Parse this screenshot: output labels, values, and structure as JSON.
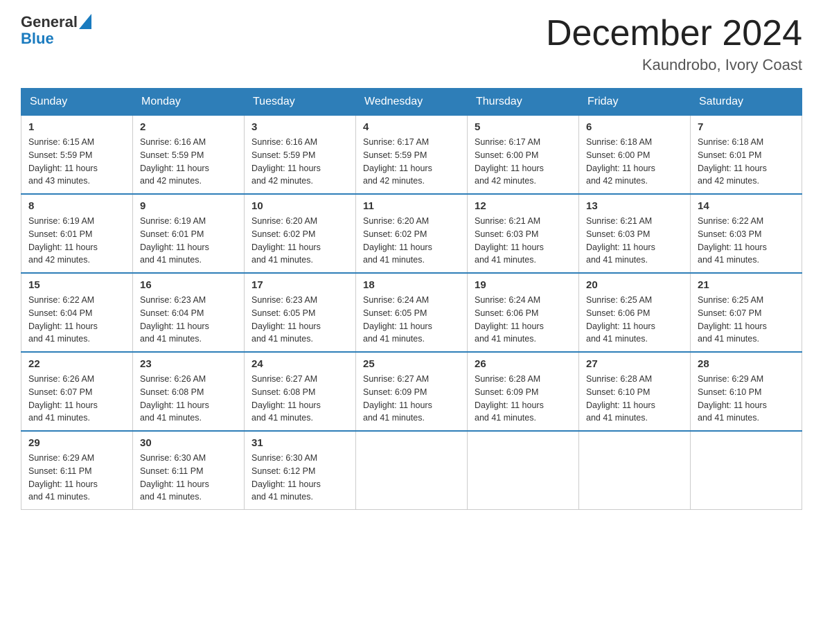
{
  "header": {
    "logo": {
      "general": "General",
      "blue": "Blue"
    },
    "title": "December 2024",
    "location": "Kaundrobo, Ivory Coast"
  },
  "days_of_week": [
    "Sunday",
    "Monday",
    "Tuesday",
    "Wednesday",
    "Thursday",
    "Friday",
    "Saturday"
  ],
  "weeks": [
    [
      {
        "day": "1",
        "sunrise": "6:15 AM",
        "sunset": "5:59 PM",
        "daylight": "11 hours and 43 minutes."
      },
      {
        "day": "2",
        "sunrise": "6:16 AM",
        "sunset": "5:59 PM",
        "daylight": "11 hours and 42 minutes."
      },
      {
        "day": "3",
        "sunrise": "6:16 AM",
        "sunset": "5:59 PM",
        "daylight": "11 hours and 42 minutes."
      },
      {
        "day": "4",
        "sunrise": "6:17 AM",
        "sunset": "5:59 PM",
        "daylight": "11 hours and 42 minutes."
      },
      {
        "day": "5",
        "sunrise": "6:17 AM",
        "sunset": "6:00 PM",
        "daylight": "11 hours and 42 minutes."
      },
      {
        "day": "6",
        "sunrise": "6:18 AM",
        "sunset": "6:00 PM",
        "daylight": "11 hours and 42 minutes."
      },
      {
        "day": "7",
        "sunrise": "6:18 AM",
        "sunset": "6:01 PM",
        "daylight": "11 hours and 42 minutes."
      }
    ],
    [
      {
        "day": "8",
        "sunrise": "6:19 AM",
        "sunset": "6:01 PM",
        "daylight": "11 hours and 42 minutes."
      },
      {
        "day": "9",
        "sunrise": "6:19 AM",
        "sunset": "6:01 PM",
        "daylight": "11 hours and 41 minutes."
      },
      {
        "day": "10",
        "sunrise": "6:20 AM",
        "sunset": "6:02 PM",
        "daylight": "11 hours and 41 minutes."
      },
      {
        "day": "11",
        "sunrise": "6:20 AM",
        "sunset": "6:02 PM",
        "daylight": "11 hours and 41 minutes."
      },
      {
        "day": "12",
        "sunrise": "6:21 AM",
        "sunset": "6:03 PM",
        "daylight": "11 hours and 41 minutes."
      },
      {
        "day": "13",
        "sunrise": "6:21 AM",
        "sunset": "6:03 PM",
        "daylight": "11 hours and 41 minutes."
      },
      {
        "day": "14",
        "sunrise": "6:22 AM",
        "sunset": "6:03 PM",
        "daylight": "11 hours and 41 minutes."
      }
    ],
    [
      {
        "day": "15",
        "sunrise": "6:22 AM",
        "sunset": "6:04 PM",
        "daylight": "11 hours and 41 minutes."
      },
      {
        "day": "16",
        "sunrise": "6:23 AM",
        "sunset": "6:04 PM",
        "daylight": "11 hours and 41 minutes."
      },
      {
        "day": "17",
        "sunrise": "6:23 AM",
        "sunset": "6:05 PM",
        "daylight": "11 hours and 41 minutes."
      },
      {
        "day": "18",
        "sunrise": "6:24 AM",
        "sunset": "6:05 PM",
        "daylight": "11 hours and 41 minutes."
      },
      {
        "day": "19",
        "sunrise": "6:24 AM",
        "sunset": "6:06 PM",
        "daylight": "11 hours and 41 minutes."
      },
      {
        "day": "20",
        "sunrise": "6:25 AM",
        "sunset": "6:06 PM",
        "daylight": "11 hours and 41 minutes."
      },
      {
        "day": "21",
        "sunrise": "6:25 AM",
        "sunset": "6:07 PM",
        "daylight": "11 hours and 41 minutes."
      }
    ],
    [
      {
        "day": "22",
        "sunrise": "6:26 AM",
        "sunset": "6:07 PM",
        "daylight": "11 hours and 41 minutes."
      },
      {
        "day": "23",
        "sunrise": "6:26 AM",
        "sunset": "6:08 PM",
        "daylight": "11 hours and 41 minutes."
      },
      {
        "day": "24",
        "sunrise": "6:27 AM",
        "sunset": "6:08 PM",
        "daylight": "11 hours and 41 minutes."
      },
      {
        "day": "25",
        "sunrise": "6:27 AM",
        "sunset": "6:09 PM",
        "daylight": "11 hours and 41 minutes."
      },
      {
        "day": "26",
        "sunrise": "6:28 AM",
        "sunset": "6:09 PM",
        "daylight": "11 hours and 41 minutes."
      },
      {
        "day": "27",
        "sunrise": "6:28 AM",
        "sunset": "6:10 PM",
        "daylight": "11 hours and 41 minutes."
      },
      {
        "day": "28",
        "sunrise": "6:29 AM",
        "sunset": "6:10 PM",
        "daylight": "11 hours and 41 minutes."
      }
    ],
    [
      {
        "day": "29",
        "sunrise": "6:29 AM",
        "sunset": "6:11 PM",
        "daylight": "11 hours and 41 minutes."
      },
      {
        "day": "30",
        "sunrise": "6:30 AM",
        "sunset": "6:11 PM",
        "daylight": "11 hours and 41 minutes."
      },
      {
        "day": "31",
        "sunrise": "6:30 AM",
        "sunset": "6:12 PM",
        "daylight": "11 hours and 41 minutes."
      },
      null,
      null,
      null,
      null
    ]
  ],
  "labels": {
    "sunrise": "Sunrise:",
    "sunset": "Sunset:",
    "daylight": "Daylight:"
  },
  "colors": {
    "header_bg": "#2e7eb8",
    "header_text": "#ffffff",
    "border_accent": "#2e7eb8"
  }
}
